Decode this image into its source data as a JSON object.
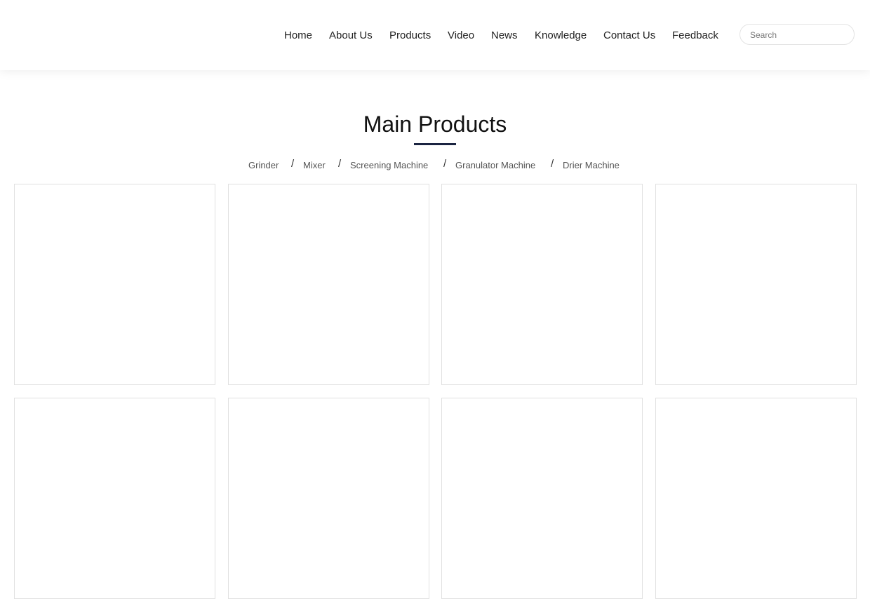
{
  "header": {
    "nav": [
      {
        "label": "Home"
      },
      {
        "label": "About Us"
      },
      {
        "label": "Products"
      },
      {
        "label": "Video"
      },
      {
        "label": "News"
      },
      {
        "label": "Knowledge"
      },
      {
        "label": "Contact Us"
      },
      {
        "label": "Feedback"
      }
    ],
    "search": {
      "placeholder": "Search",
      "value": ""
    }
  },
  "main": {
    "title": "Main Products",
    "categories": [
      {
        "label": "Grinder"
      },
      {
        "label": "Mixer"
      },
      {
        "label": "Screening Machine"
      },
      {
        "label": "Granulator Machine"
      },
      {
        "label": "Drier Machine"
      }
    ],
    "separator": "/"
  },
  "colors": {
    "accent": "#1b2441",
    "card_border": "#e1e1e1"
  }
}
